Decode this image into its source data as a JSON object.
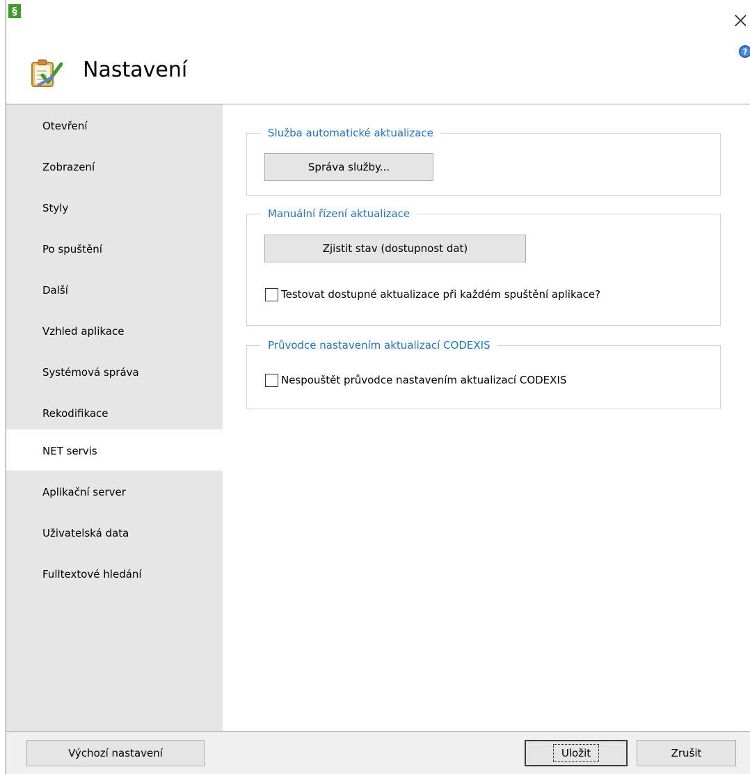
{
  "window": {
    "app_icon_glyph": "§",
    "title": "Nastavení",
    "close_glyph": "×"
  },
  "sidebar": {
    "items": [
      {
        "label": "Otevření"
      },
      {
        "label": "Zobrazení"
      },
      {
        "label": "Styly"
      },
      {
        "label": "Po spuštění"
      },
      {
        "label": "Další"
      },
      {
        "label": "Vzhled aplikace"
      },
      {
        "label": "Systémová správa"
      },
      {
        "label": "Rekodifikace"
      },
      {
        "label": "NET servis"
      },
      {
        "label": "Aplikační server"
      },
      {
        "label": "Uživatelská data"
      },
      {
        "label": "Fulltextové hledání"
      }
    ],
    "selected": "NET servis"
  },
  "groups": {
    "service": {
      "title": "Služba automatické aktualizace",
      "manage_button": "Správa služby..."
    },
    "manual": {
      "title": "Manuální řízení aktualizace",
      "check_button": "Zjistit stav (dostupnost dat)",
      "test_checkbox_label": "Testovat dostupné aktualizace při každém spuštění aplikace?",
      "test_checkbox_checked": false
    },
    "wizard": {
      "title": "Průvodce nastavením aktualizací CODEXIS",
      "skip_checkbox_label": "Nespouštět průvodce nastavením aktualizací CODEXIS",
      "skip_checkbox_checked": false
    }
  },
  "footer": {
    "defaults_button": "Výchozí nastavení",
    "save_button": "Uložit",
    "cancel_button": "Zrušit"
  },
  "colors": {
    "group_title": "#1e74c6",
    "sidebar_bg": "#e6e6e6",
    "app_icon_bg": "#3e9b2a",
    "help_icon": "#1f5fb8"
  },
  "icons": {
    "app": "app-logo-icon",
    "header": "settings-checklist-icon",
    "help": "help-icon",
    "close": "close-icon"
  }
}
